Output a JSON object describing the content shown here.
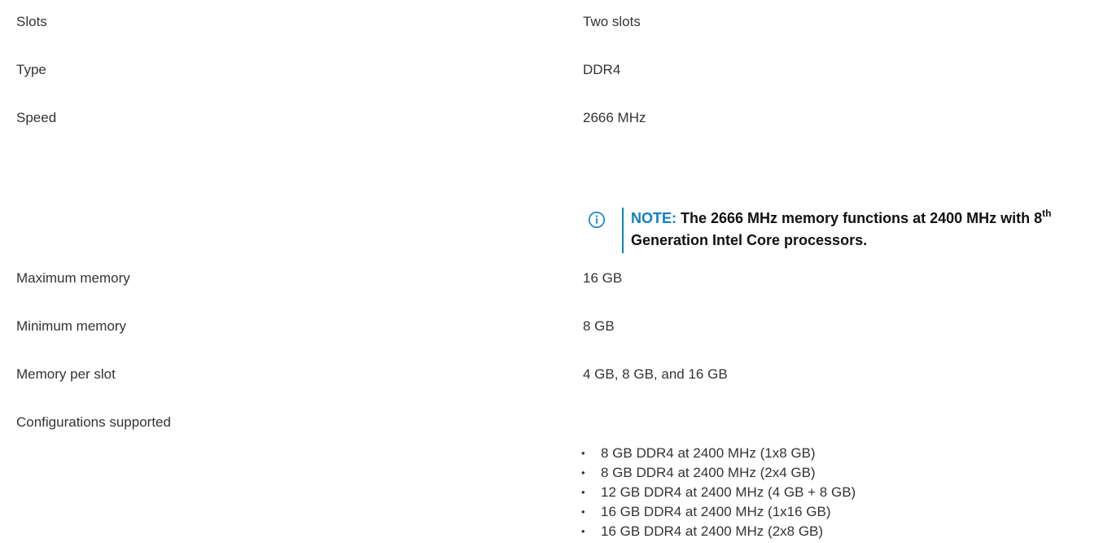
{
  "specs": {
    "slots": {
      "label": "Slots",
      "value": "Two slots"
    },
    "type": {
      "label": "Type",
      "value": "DDR4"
    },
    "speed": {
      "label": "Speed",
      "value": "2666 MHz"
    },
    "note": {
      "prefix": "NOTE:",
      "text_before_sup": " The 2666 MHz memory functions at 2400 MHz with 8",
      "sup": "th",
      "text_after_sup": " Generation Intel Core processors.",
      "icon": "info-circle-icon",
      "accent_color": "#0e7fc1"
    },
    "max_memory": {
      "label": "Maximum memory",
      "value": "16 GB"
    },
    "min_memory": {
      "label": "Minimum memory",
      "value": "8 GB"
    },
    "per_slot": {
      "label": "Memory per slot",
      "value": "4 GB, 8 GB, and 16 GB"
    },
    "configurations": {
      "label": "Configurations supported",
      "items": [
        "8 GB DDR4 at 2400 MHz (1x8 GB)",
        "8 GB DDR4 at 2400 MHz (2x4 GB)",
        "12 GB DDR4 at 2400 MHz (4 GB + 8 GB)",
        "16 GB DDR4 at 2400 MHz (1x16 GB)",
        "16 GB DDR4 at 2400 MHz (2x8 GB)"
      ],
      "bullet": "•"
    }
  }
}
